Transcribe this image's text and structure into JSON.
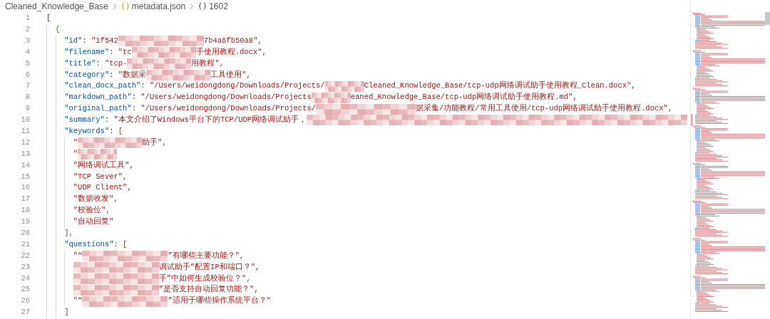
{
  "breadcrumb": [
    {
      "kind": "folder",
      "text": "Cleaned_Knowledge_Base"
    },
    {
      "kind": "file",
      "text": "metadata.json"
    },
    {
      "kind": "object",
      "text": "1602"
    }
  ],
  "lines": [
    {
      "number": "1",
      "tokens": [
        {
          "kind": "bracket",
          "text": "["
        }
      ],
      "children": [
        {
          "number": "2",
          "tokens": [
            {
              "kind": "bracket",
              "text": "{"
            }
          ],
          "children": [
            {
              "number": "3",
              "tokens": [
                {
                  "kind": "key",
                  "text": "\"id\""
                },
                {
                  "kind": "punct",
                  "text": ": "
                },
                {
                  "kind": "string",
                  "text": "\"1f542"
                },
                {
                  "kind": "blurlong"
                },
                {
                  "kind": "string",
                  "text": "7b4a6fb50a8\""
                },
                {
                  "kind": "punct",
                  "text": ","
                }
              ]
            },
            {
              "number": "4",
              "tokens": [
                {
                  "kind": "key",
                  "text": "\"filename\""
                },
                {
                  "kind": "punct",
                  "text": ": "
                },
                {
                  "kind": "string",
                  "text": "\"tc"
                },
                {
                  "kind": "blurmedium"
                },
                {
                  "kind": "string",
                  "text": "手使用教程.docx\""
                },
                {
                  "kind": "punct",
                  "text": ","
                }
              ]
            },
            {
              "number": "5",
              "tokens": [
                {
                  "kind": "key",
                  "text": "\"title\""
                },
                {
                  "kind": "punct",
                  "text": ": "
                },
                {
                  "kind": "string",
                  "text": "\"tcp-"
                },
                {
                  "kind": "blurmedium"
                },
                {
                  "kind": "string",
                  "text": "用教程\""
                },
                {
                  "kind": "punct",
                  "text": ","
                }
              ]
            },
            {
              "number": "6",
              "tokens": [
                {
                  "kind": "key",
                  "text": "\"category\""
                },
                {
                  "kind": "punct",
                  "text": ": "
                },
                {
                  "kind": "string",
                  "text": "\"数据采"
                },
                {
                  "kind": "blurmedium"
                },
                {
                  "kind": "string",
                  "text": "工具使用\""
                },
                {
                  "kind": "punct",
                  "text": ","
                }
              ]
            },
            {
              "number": "7",
              "tokens": [
                {
                  "kind": "key",
                  "text": "\"clean_docx_path\""
                },
                {
                  "kind": "punct",
                  "text": ": "
                },
                {
                  "kind": "string",
                  "text": "\"/Users/weidongdong/Downloads/Projects/"
                },
                {
                  "kind": "blurshort"
                },
                {
                  "kind": "string",
                  "text": "Cleaned_Knowledge_Base/tcp-udp网络调试助手使用教程_Clean.docx\""
                },
                {
                  "kind": "punct",
                  "text": ","
                }
              ]
            },
            {
              "number": "8",
              "tokens": [
                {
                  "kind": "key",
                  "text": "\"markdown_path\""
                },
                {
                  "kind": "punct",
                  "text": ": "
                },
                {
                  "kind": "string",
                  "text": "\"/Users/weidongdong/Downloads/Projects"
                },
                {
                  "kind": "blurshort"
                },
                {
                  "kind": "string",
                  "text": "eaned_Knowledge_Base/tcp-udp网络调试助手使用教程.md\""
                },
                {
                  "kind": "punct",
                  "text": ","
                }
              ]
            },
            {
              "number": "9",
              "tokens": [
                {
                  "kind": "key",
                  "text": "\"original_path\""
                },
                {
                  "kind": "punct",
                  "text": ": "
                },
                {
                  "kind": "string",
                  "text": "\"/Users/weidongdong/Downloads/Projects/"
                },
                {
                  "kind": "blurxlong"
                },
                {
                  "kind": "string",
                  "text": "据采集/功能教程/常用工具使用/tcp-udp网络调试助手使用教程.docx\""
                },
                {
                  "kind": "punct",
                  "text": ","
                }
              ]
            },
            {
              "number": "10",
              "tokens": [
                {
                  "kind": "key",
                  "text": "\"summary\""
                },
                {
                  "kind": "punct",
                  "text": ": "
                },
                {
                  "kind": "string",
                  "text": "\"本文介绍了Windows平台下的TCP/UDP网络调试助手，"
                },
                {
                  "kind": "blurfill"
                }
              ]
            },
            {
              "number": "11",
              "tokens": [
                {
                  "kind": "key",
                  "text": "\"keywords\""
                },
                {
                  "kind": "punct",
                  "text": ": "
                },
                {
                  "kind": "bracket",
                  "text": "["
                }
              ],
              "children": [
                {
                  "number": "12",
                  "tokens": [
                    {
                      "kind": "string",
                      "text": "\""
                    },
                    {
                      "kind": "blurmedium"
                    },
                    {
                      "kind": "string",
                      "text": "助手\""
                    },
                    {
                      "kind": "punct",
                      "text": ","
                    }
                  ]
                },
                {
                  "number": "13",
                  "tokens": [
                    {
                      "kind": "string",
                      "text": "\""
                    },
                    {
                      "kind": "blurshort"
                    }
                  ]
                },
                {
                  "number": "14",
                  "tokens": [
                    {
                      "kind": "string",
                      "text": "\"网络调试工具\""
                    },
                    {
                      "kind": "punct",
                      "text": ","
                    }
                  ]
                },
                {
                  "number": "15",
                  "tokens": [
                    {
                      "kind": "string",
                      "text": "\"TCP Sever\""
                    },
                    {
                      "kind": "punct",
                      "text": ","
                    }
                  ]
                },
                {
                  "number": "16",
                  "tokens": [
                    {
                      "kind": "string",
                      "text": "\"UDP Client\""
                    },
                    {
                      "kind": "punct",
                      "text": ","
                    }
                  ]
                },
                {
                  "number": "17",
                  "tokens": [
                    {
                      "kind": "string",
                      "text": "\"数据收发\""
                    },
                    {
                      "kind": "punct",
                      "text": ","
                    }
                  ]
                },
                {
                  "number": "18",
                  "tokens": [
                    {
                      "kind": "string",
                      "text": "\"校验位\""
                    },
                    {
                      "kind": "punct",
                      "text": ","
                    }
                  ]
                },
                {
                  "number": "19",
                  "tokens": [
                    {
                      "kind": "string",
                      "text": "\"自动回复\""
                    }
                  ]
                }
              ]
            },
            {
              "number": "20",
              "tokens": [
                {
                  "kind": "bracket",
                  "text": "]"
                },
                {
                  "kind": "punct",
                  "text": ","
                }
              ]
            },
            {
              "number": "21",
              "tokens": [
                {
                  "kind": "key",
                  "text": "\"questions\""
                },
                {
                  "kind": "punct",
                  "text": ": "
                },
                {
                  "kind": "bracket",
                  "text": "["
                }
              ],
              "children": [
                {
                  "number": "22",
                  "tokens": [
                    {
                      "kind": "string",
                      "text": "\"“"
                    },
                    {
                      "kind": "blurlong"
                    },
                    {
                      "kind": "string",
                      "text": "”有哪些主要功能？\""
                    },
                    {
                      "kind": "punct",
                      "text": ","
                    }
                  ]
                },
                {
                  "number": "23",
                  "tokens": [
                    {
                      "kind": "blurlong"
                    },
                    {
                      "kind": "string",
                      "text": "调试助手”配置IP和端口？\""
                    },
                    {
                      "kind": "punct",
                      "text": ","
                    }
                  ]
                },
                {
                  "number": "24",
                  "tokens": [
                    {
                      "kind": "blurlong"
                    },
                    {
                      "kind": "string",
                      "text": "手”中如何生成校验位？\""
                    },
                    {
                      "kind": "punct",
                      "text": ","
                    }
                  ]
                },
                {
                  "number": "25",
                  "tokens": [
                    {
                      "kind": "blurlong"
                    },
                    {
                      "kind": "string",
                      "text": "”是否支持自动回复功能？\""
                    },
                    {
                      "kind": "punct",
                      "text": ","
                    }
                  ]
                },
                {
                  "number": "26",
                  "tokens": [
                    {
                      "kind": "string",
                      "text": "\"“"
                    },
                    {
                      "kind": "blurlong"
                    },
                    {
                      "kind": "string",
                      "text": "”适用于哪些操作系统平台？\""
                    }
                  ]
                }
              ]
            },
            {
              "number": "27",
              "tokens": [
                {
                  "kind": "bracket",
                  "text": "]"
                }
              ]
            }
          ]
        }
      ]
    }
  ]
}
